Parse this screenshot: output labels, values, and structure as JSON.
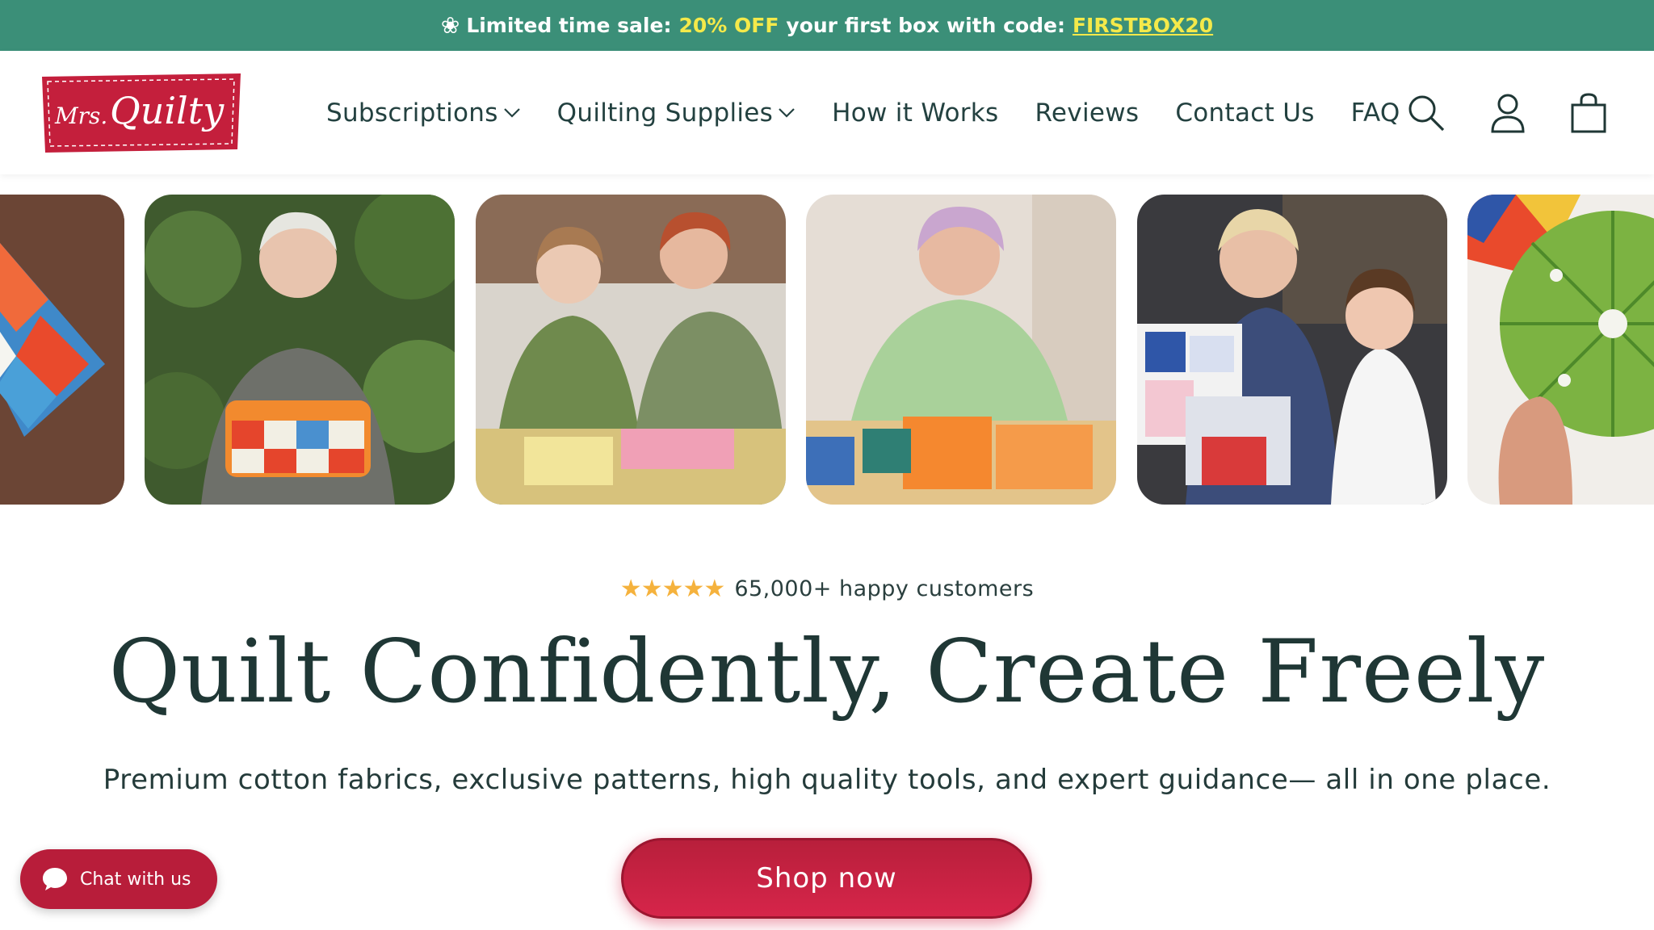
{
  "announcement": {
    "icon": "flower-icon",
    "lead": "Limited time sale:",
    "highlight": "20% OFF",
    "middle": "your first box with code:",
    "code": "FIRSTBOX20"
  },
  "brand": {
    "logo_text": "Mrs. Quilty",
    "logo_color": "#c41f3c"
  },
  "nav": {
    "items": [
      {
        "label": "Subscriptions",
        "has_dropdown": true
      },
      {
        "label": "Quilting Supplies",
        "has_dropdown": true
      },
      {
        "label": "How it Works",
        "has_dropdown": false
      },
      {
        "label": "Reviews",
        "has_dropdown": false
      },
      {
        "label": "Contact Us",
        "has_dropdown": false
      },
      {
        "label": "FAQ",
        "has_dropdown": false
      }
    ]
  },
  "header_icons": [
    "search-icon",
    "account-icon",
    "cart-icon"
  ],
  "gallery": {
    "images": [
      "patchwork-pillow",
      "woman-holding-fabric-basket",
      "girl-and-woman-sewing",
      "woman-cutting-fabric",
      "grandmother-and-girl-with-fabric-bundles",
      "green-pincushion"
    ]
  },
  "hero": {
    "rating_stars": 5,
    "rating_text": "65,000+ happy customers",
    "title": "Quilt Confidently, Create Freely",
    "subtitle": "Premium cotton fabrics, exclusive patterns, high quality tools, and expert guidance— all in one place.",
    "cta_label": "Shop now"
  },
  "chat": {
    "label": "Chat with us"
  },
  "colors": {
    "announcement_bg": "#3b8f78",
    "highlight": "#f4e94a",
    "brand_red": "#c41f3c",
    "text_dark": "#1f3735",
    "star": "#f5b23d"
  }
}
